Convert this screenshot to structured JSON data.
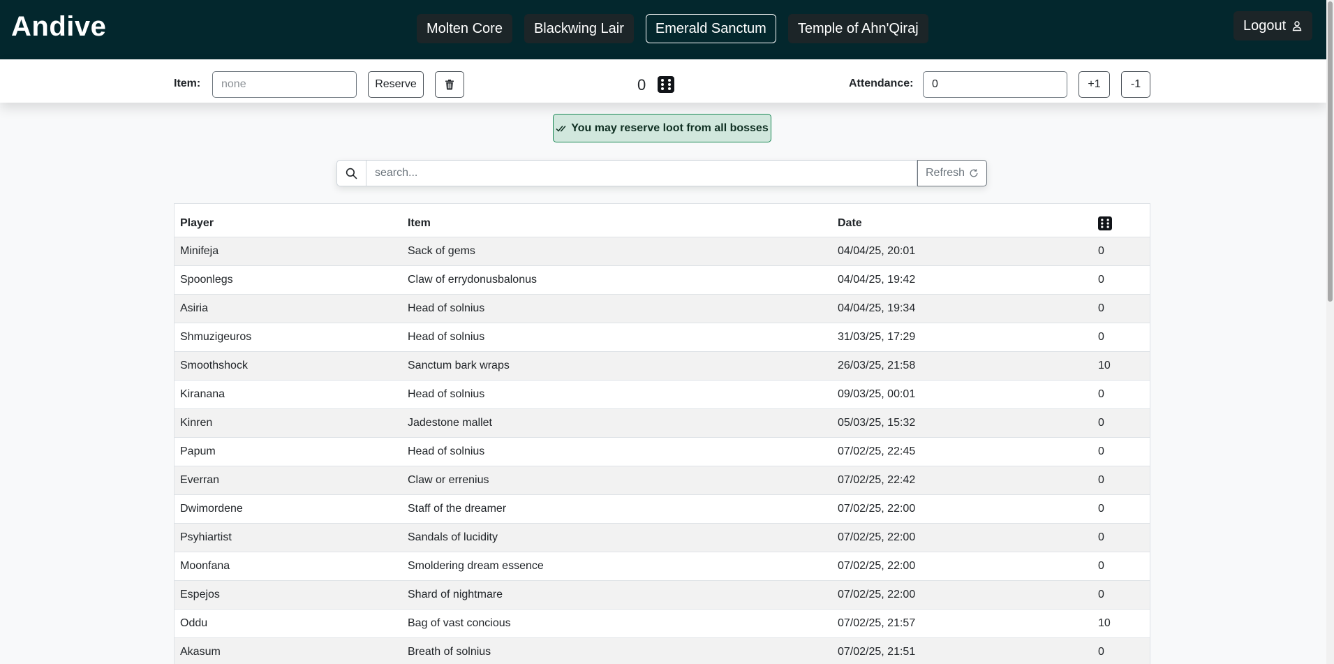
{
  "app": {
    "brand": "Andive"
  },
  "nav": {
    "tabs": [
      {
        "label": "Molten Core",
        "active": false
      },
      {
        "label": "Blackwing Lair",
        "active": false
      },
      {
        "label": "Emerald Sanctum",
        "active": true
      },
      {
        "label": "Temple of Ahn'Qiraj",
        "active": false
      }
    ],
    "logout_label": "Logout"
  },
  "toolbar": {
    "item_label": "Item:",
    "item_placeholder": "none",
    "reserve_label": "Reserve",
    "roll_count": "0",
    "attendance_label": "Attendance:",
    "attendance_value": "0",
    "plus_label": "+1",
    "minus_label": "-1"
  },
  "alert": {
    "text": "You may reserve loot from all bosses"
  },
  "search": {
    "placeholder": "search...",
    "refresh_label": "Refresh"
  },
  "table": {
    "headers": {
      "player": "Player",
      "item": "Item",
      "date": "Date"
    },
    "rows": [
      {
        "player": "Minifeja",
        "item": "Sack of gems",
        "date": "04/04/25, 20:01",
        "roll": "0"
      },
      {
        "player": "Spoonlegs",
        "item": "Claw of errydonusbalonus",
        "date": "04/04/25, 19:42",
        "roll": "0"
      },
      {
        "player": "Asiria",
        "item": "Head of solnius",
        "date": "04/04/25, 19:34",
        "roll": "0"
      },
      {
        "player": "Shmuzigeuros",
        "item": "Head of solnius",
        "date": "31/03/25, 17:29",
        "roll": "0"
      },
      {
        "player": "Smoothshock",
        "item": "Sanctum bark wraps",
        "date": "26/03/25, 21:58",
        "roll": "10"
      },
      {
        "player": "Kiranana",
        "item": "Head of solnius",
        "date": "09/03/25, 00:01",
        "roll": "0"
      },
      {
        "player": "Kinren",
        "item": "Jadestone mallet",
        "date": "05/03/25, 15:32",
        "roll": "0"
      },
      {
        "player": "Papum",
        "item": "Head of solnius",
        "date": "07/02/25, 22:45",
        "roll": "0"
      },
      {
        "player": "Everran",
        "item": "Claw or errenius",
        "date": "07/02/25, 22:42",
        "roll": "0"
      },
      {
        "player": "Dwimordene",
        "item": "Staff of the dreamer",
        "date": "07/02/25, 22:00",
        "roll": "0"
      },
      {
        "player": "Psyhiartist",
        "item": "Sandals of lucidity",
        "date": "07/02/25, 22:00",
        "roll": "0"
      },
      {
        "player": "Moonfana",
        "item": "Smoldering dream essence",
        "date": "07/02/25, 22:00",
        "roll": "0"
      },
      {
        "player": "Espejos",
        "item": "Shard of nightmare",
        "date": "07/02/25, 22:00",
        "roll": "0"
      },
      {
        "player": "Oddu",
        "item": "Bag of vast concious",
        "date": "07/02/25, 21:57",
        "roll": "10"
      },
      {
        "player": "Akasum",
        "item": "Breath of solnius",
        "date": "07/02/25, 21:51",
        "roll": "0"
      },
      {
        "player": "",
        "item": "",
        "date": "",
        "roll": ""
      }
    ]
  },
  "icons": {
    "logout": "user-icon",
    "delete": "trash-icon",
    "roll": "dice-six-icon",
    "alert": "double-check-icon",
    "search": "search-icon",
    "refresh": "refresh-icon"
  },
  "colors": {
    "navbar": "#03272d",
    "nav_button": "#1c2528",
    "alert_bg": "#d1e7dd",
    "alert_border": "#198754",
    "row_stripe": "#f2f2f2"
  }
}
